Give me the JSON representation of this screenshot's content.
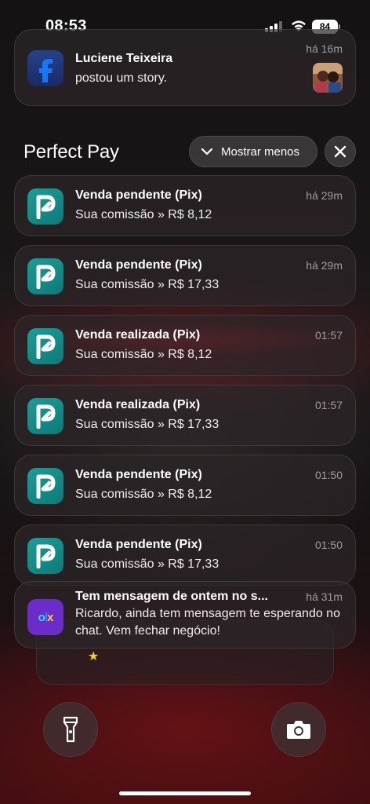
{
  "status_bar": {
    "time": "08:53",
    "battery": "84"
  },
  "facebook_notification": {
    "title": "Luciene Teixeira",
    "body": "postou um story.",
    "time": "há 16m",
    "icon": "facebook-icon"
  },
  "group": {
    "title": "Perfect Pay",
    "show_less_label": "Mostrar menos"
  },
  "notifications": [
    {
      "title": "Venda pendente (Pix)",
      "body": "Sua comissão » R$ 8,12",
      "time": "há 29m"
    },
    {
      "title": "Venda pendente (Pix)",
      "body": "Sua comissão » R$ 17,33",
      "time": "há 29m"
    },
    {
      "title": "Venda realizada (Pix)",
      "body": "Sua comissão » R$ 8,12",
      "time": "01:57"
    },
    {
      "title": "Venda realizada (Pix)",
      "body": "Sua comissão » R$ 17,33",
      "time": "01:57"
    },
    {
      "title": "Venda pendente (Pix)",
      "body": "Sua comissão » R$ 8,12",
      "time": "01:50"
    },
    {
      "title": "Venda pendente (Pix)",
      "body": "Sua comissão » R$ 17,33",
      "time": "01:50"
    }
  ],
  "olx_notification": {
    "title": "Tem mensagem de ontem no s...",
    "body": "Ricardo, ainda tem mensagem te esperando no chat. Vem fechar negócio!",
    "time": "há 31m",
    "icon_text": "olx"
  },
  "lockscreen": {
    "flashlight_icon": "flashlight-icon",
    "camera_icon": "camera-icon"
  },
  "colors": {
    "perfect_pay_accent": "#128b88",
    "facebook_blue": "#1877f2",
    "olx_purple": "#6b2cc9"
  }
}
